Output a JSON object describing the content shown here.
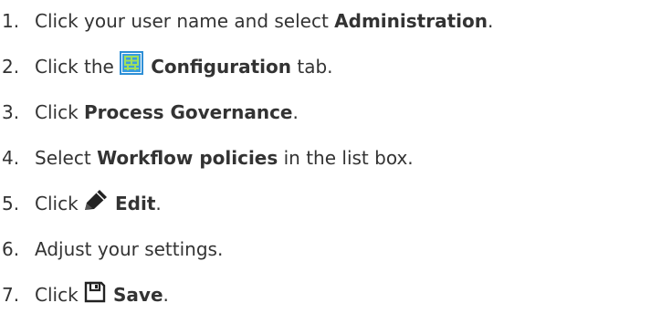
{
  "steps": [
    {
      "number": "1.",
      "before": "Click your user name and select ",
      "bold": "Administration",
      "after": "."
    },
    {
      "number": "2.",
      "before": "Click the ",
      "icon": "configuration-icon",
      "bold": "Configuration",
      "after": " tab."
    },
    {
      "number": "3.",
      "before": "Click ",
      "bold": "Process Governance",
      "after": "."
    },
    {
      "number": "4.",
      "before": "Select ",
      "bold": "Workflow policies",
      "after": " in the list box."
    },
    {
      "number": "5.",
      "before": "Click ",
      "icon": "edit-pencil-icon",
      "bold": "Edit",
      "after": "."
    },
    {
      "number": "6.",
      "before": "Adjust your settings.",
      "bold": "",
      "after": ""
    },
    {
      "number": "7.",
      "before": "Click ",
      "icon": "save-floppy-icon",
      "bold": "Save",
      "after": "."
    }
  ],
  "colors": {
    "text": "#333333",
    "config_icon_bg": "#2e8fd6",
    "config_icon_grid": "#9fe05a"
  }
}
